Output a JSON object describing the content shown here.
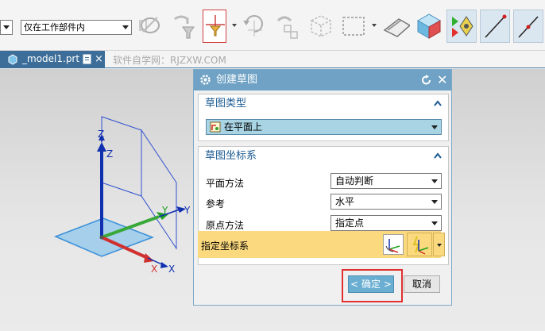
{
  "toolbar": {
    "combo_left_text": "",
    "combo_filter_text": "仅在工作部件内",
    "icons": [
      "csys-icon",
      "filter-funnel-icon",
      "snap-point-icon",
      "undo-rotate-icon",
      "assembly-icon",
      "wireframe-cube-icon",
      "box-select-icon",
      "view-eraser-icon",
      "shaded-cube-icon",
      "snap-grid-icon",
      "line-icon",
      "point-on-line-icon"
    ]
  },
  "tabs": {
    "active_label": "_model1.prt",
    "close_glyph": "×",
    "watermark": "软件自学网：RJZXW.COM"
  },
  "viewport": {
    "axis_z_outer": "Z",
    "axis_z_inner": "Z",
    "axis_y_outer": "Y",
    "axis_y_inner": "Y",
    "axis_x_outer": "X",
    "axis_x_inner": "X"
  },
  "dialog": {
    "title": "创建草图",
    "close_glyph": "✕",
    "type_group": {
      "title": "草图类型",
      "value": "在平面上"
    },
    "csys_group": {
      "title": "草图坐标系",
      "rows": [
        {
          "label": "平面方法",
          "value": "自动判断"
        },
        {
          "label": "参考",
          "value": "水平"
        },
        {
          "label": "原点方法",
          "value": "指定点"
        }
      ],
      "specify_label": "指定坐标系"
    },
    "ok_label": "< 确定 >",
    "cancel_label": "取消"
  },
  "colors": {
    "dialog_title_bg": "#6fa2c4",
    "group_header_text": "#1b5a92",
    "highlight_row": "#fbd97e",
    "ok_button": "#6aaed2",
    "callout_red": "#e03030"
  }
}
